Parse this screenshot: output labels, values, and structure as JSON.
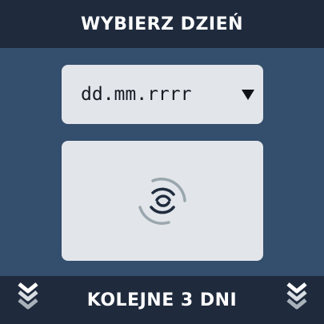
{
  "header": {
    "title": "WYBIERZ DZIEŃ"
  },
  "date_picker": {
    "value": "dd.mm.rrrr",
    "dropdown_icon": "caret-down-icon"
  },
  "panel": {
    "icon": "loading-spinner-icon"
  },
  "footer": {
    "label": "KOLEJNE 3 DNI",
    "icon": "double-chevron-down-icon"
  },
  "colors": {
    "background": "#344f6d",
    "bar": "#1f2b3d",
    "card": "#e2e5ea",
    "text_light": "#ffffff",
    "text_dark": "#151a22"
  }
}
